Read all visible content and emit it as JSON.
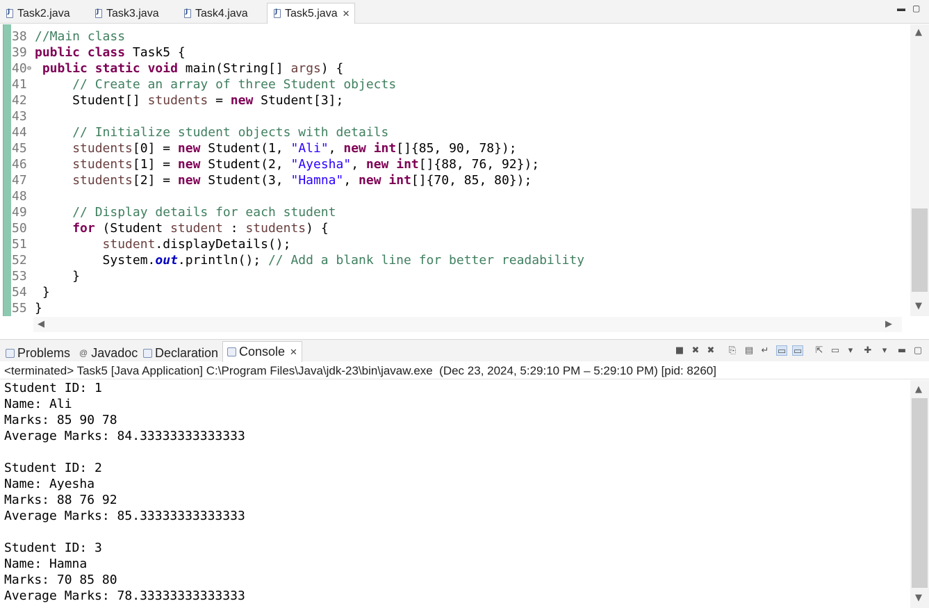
{
  "tabs": [
    {
      "label": "Task2.java"
    },
    {
      "label": "Task3.java"
    },
    {
      "label": "Task4.java"
    },
    {
      "label": "Task5.java",
      "active": true
    }
  ],
  "editor": {
    "lines": [
      {
        "num": "38",
        "segs": [
          {
            "t": "//Main class",
            "c": "cm"
          }
        ]
      },
      {
        "num": "39",
        "segs": [
          {
            "t": "public",
            "c": "kw"
          },
          {
            "t": " "
          },
          {
            "t": "class",
            "c": "kw"
          },
          {
            "t": " Task5 {"
          }
        ]
      },
      {
        "num": "40",
        "fold": true,
        "segs": [
          {
            "t": " "
          },
          {
            "t": "public",
            "c": "kw"
          },
          {
            "t": " "
          },
          {
            "t": "static",
            "c": "kw"
          },
          {
            "t": " "
          },
          {
            "t": "void",
            "c": "kw"
          },
          {
            "t": " main(String[] "
          },
          {
            "t": "args",
            "c": "var"
          },
          {
            "t": ") {"
          }
        ]
      },
      {
        "num": "41",
        "segs": [
          {
            "t": "     "
          },
          {
            "t": "// Create an array of three Student objects",
            "c": "cm"
          }
        ]
      },
      {
        "num": "42",
        "segs": [
          {
            "t": "     Student[] "
          },
          {
            "t": "students",
            "c": "var"
          },
          {
            "t": " = "
          },
          {
            "t": "new",
            "c": "kw"
          },
          {
            "t": " Student[3];"
          }
        ]
      },
      {
        "num": "43",
        "segs": []
      },
      {
        "num": "44",
        "segs": [
          {
            "t": "     "
          },
          {
            "t": "// Initialize student objects with details",
            "c": "cm"
          }
        ]
      },
      {
        "num": "45",
        "segs": [
          {
            "t": "     "
          },
          {
            "t": "students",
            "c": "var"
          },
          {
            "t": "[0] = "
          },
          {
            "t": "new",
            "c": "kw"
          },
          {
            "t": " Student(1, "
          },
          {
            "t": "\"Ali\"",
            "c": "st"
          },
          {
            "t": ", "
          },
          {
            "t": "new",
            "c": "kw"
          },
          {
            "t": " "
          },
          {
            "t": "int",
            "c": "kw"
          },
          {
            "t": "[]{85, 90, 78});"
          }
        ]
      },
      {
        "num": "46",
        "segs": [
          {
            "t": "     "
          },
          {
            "t": "students",
            "c": "var"
          },
          {
            "t": "[1] = "
          },
          {
            "t": "new",
            "c": "kw"
          },
          {
            "t": " Student(2, "
          },
          {
            "t": "\"Ayesha\"",
            "c": "st"
          },
          {
            "t": ", "
          },
          {
            "t": "new",
            "c": "kw"
          },
          {
            "t": " "
          },
          {
            "t": "int",
            "c": "kw"
          },
          {
            "t": "[]{88, 76, 92});"
          }
        ]
      },
      {
        "num": "47",
        "segs": [
          {
            "t": "     "
          },
          {
            "t": "students",
            "c": "var"
          },
          {
            "t": "[2] = "
          },
          {
            "t": "new",
            "c": "kw"
          },
          {
            "t": " Student(3, "
          },
          {
            "t": "\"Hamna\"",
            "c": "st"
          },
          {
            "t": ", "
          },
          {
            "t": "new",
            "c": "kw"
          },
          {
            "t": " "
          },
          {
            "t": "int",
            "c": "kw"
          },
          {
            "t": "[]{70, 85, 80});"
          }
        ]
      },
      {
        "num": "48",
        "segs": []
      },
      {
        "num": "49",
        "segs": [
          {
            "t": "     "
          },
          {
            "t": "// Display details for each student",
            "c": "cm"
          }
        ]
      },
      {
        "num": "50",
        "segs": [
          {
            "t": "     "
          },
          {
            "t": "for",
            "c": "kw"
          },
          {
            "t": " (Student "
          },
          {
            "t": "student",
            "c": "var"
          },
          {
            "t": " : "
          },
          {
            "t": "students",
            "c": "var"
          },
          {
            "t": ") {"
          }
        ]
      },
      {
        "num": "51",
        "segs": [
          {
            "t": "         "
          },
          {
            "t": "student",
            "c": "var"
          },
          {
            "t": ".displayDetails();"
          }
        ]
      },
      {
        "num": "52",
        "segs": [
          {
            "t": "         System."
          },
          {
            "t": "out",
            "c": "fld"
          },
          {
            "t": ".println(); "
          },
          {
            "t": "// Add a blank line for better readability",
            "c": "cm"
          }
        ]
      },
      {
        "num": "53",
        "segs": [
          {
            "t": "     }"
          }
        ]
      },
      {
        "num": "54",
        "segs": [
          {
            "t": " }"
          }
        ]
      },
      {
        "num": "55",
        "segs": [
          {
            "t": "}"
          }
        ]
      }
    ]
  },
  "panel": {
    "tabs": [
      {
        "label": "Problems"
      },
      {
        "label": "Javadoc"
      },
      {
        "label": "Declaration"
      },
      {
        "label": "Console",
        "active": true
      }
    ],
    "status": "<terminated> Task5 [Java Application] C:\\Program Files\\Java\\jdk-23\\bin\\javaw.exe  (Dec 23, 2024, 5:29:10 PM – 5:29:10 PM) [pid: 8260]"
  },
  "console": {
    "lines": [
      "Student ID: 1",
      "Name: Ali",
      "Marks: 85 90 78",
      "Average Marks: 84.33333333333333",
      "",
      "Student ID: 2",
      "Name: Ayesha",
      "Marks: 88 76 92",
      "Average Marks: 85.33333333333333",
      "",
      "Student ID: 3",
      "Name: Hamna",
      "Marks: 70 85 80",
      "Average Marks: 78.33333333333333"
    ]
  },
  "icons": {
    "minimize": "minimize-icon",
    "maximize": "maximize-icon",
    "close": "close-icon"
  }
}
